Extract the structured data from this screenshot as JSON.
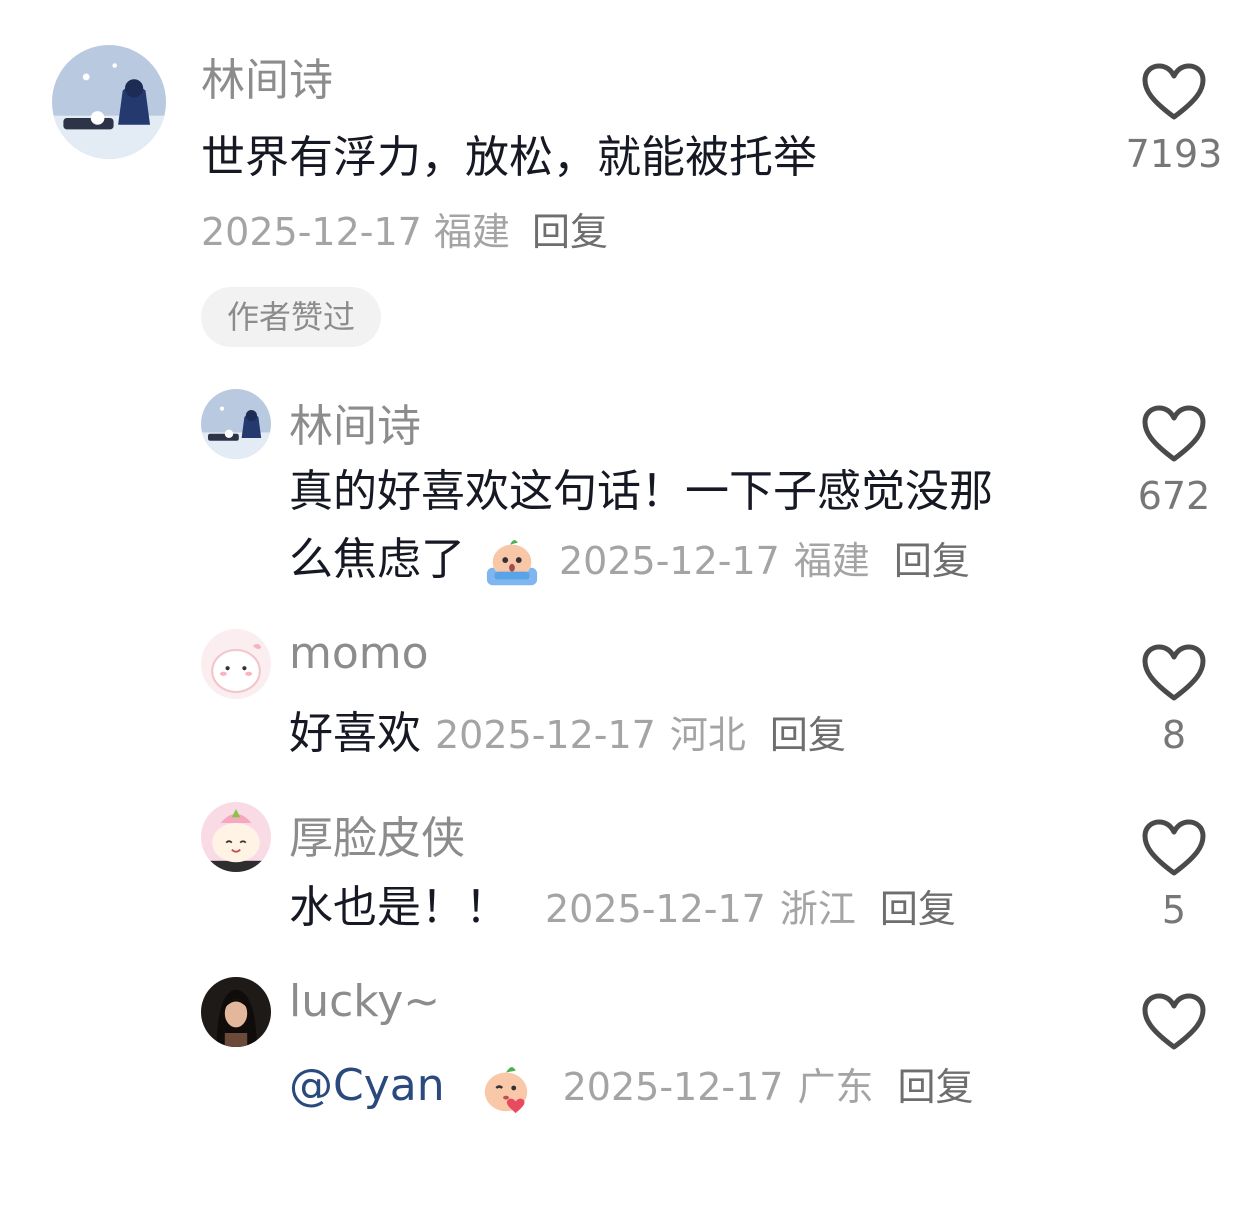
{
  "comments": [
    {
      "username": "林间诗",
      "text": "世界有浮力，放松，就能被托举",
      "date": "2025-12-17",
      "location": "福建",
      "reply": "回复",
      "likes": "7193",
      "badge": "作者赞过"
    },
    {
      "username": "林间诗",
      "text_line1": "真的好喜欢这句话！一下子感觉没那",
      "text_line2": "么焦虑了",
      "emoji": "crying-bun-emoji",
      "date": "2025-12-17",
      "location": "福建",
      "reply": "回复",
      "likes": "672"
    },
    {
      "username": "momo",
      "text": "好喜欢",
      "date": "2025-12-17",
      "location": "河北",
      "reply": "回复",
      "likes": "8"
    },
    {
      "username": "厚脸皮侠",
      "text": "水也是！！",
      "date": "2025-12-17",
      "location": "浙江",
      "reply": "回复",
      "likes": "5"
    },
    {
      "username": "lucky~",
      "mention": "@Cyan",
      "emoji": "kiss-bun-emoji",
      "date": "2025-12-17",
      "location": "广东",
      "reply": "回复",
      "likes": ""
    }
  ]
}
